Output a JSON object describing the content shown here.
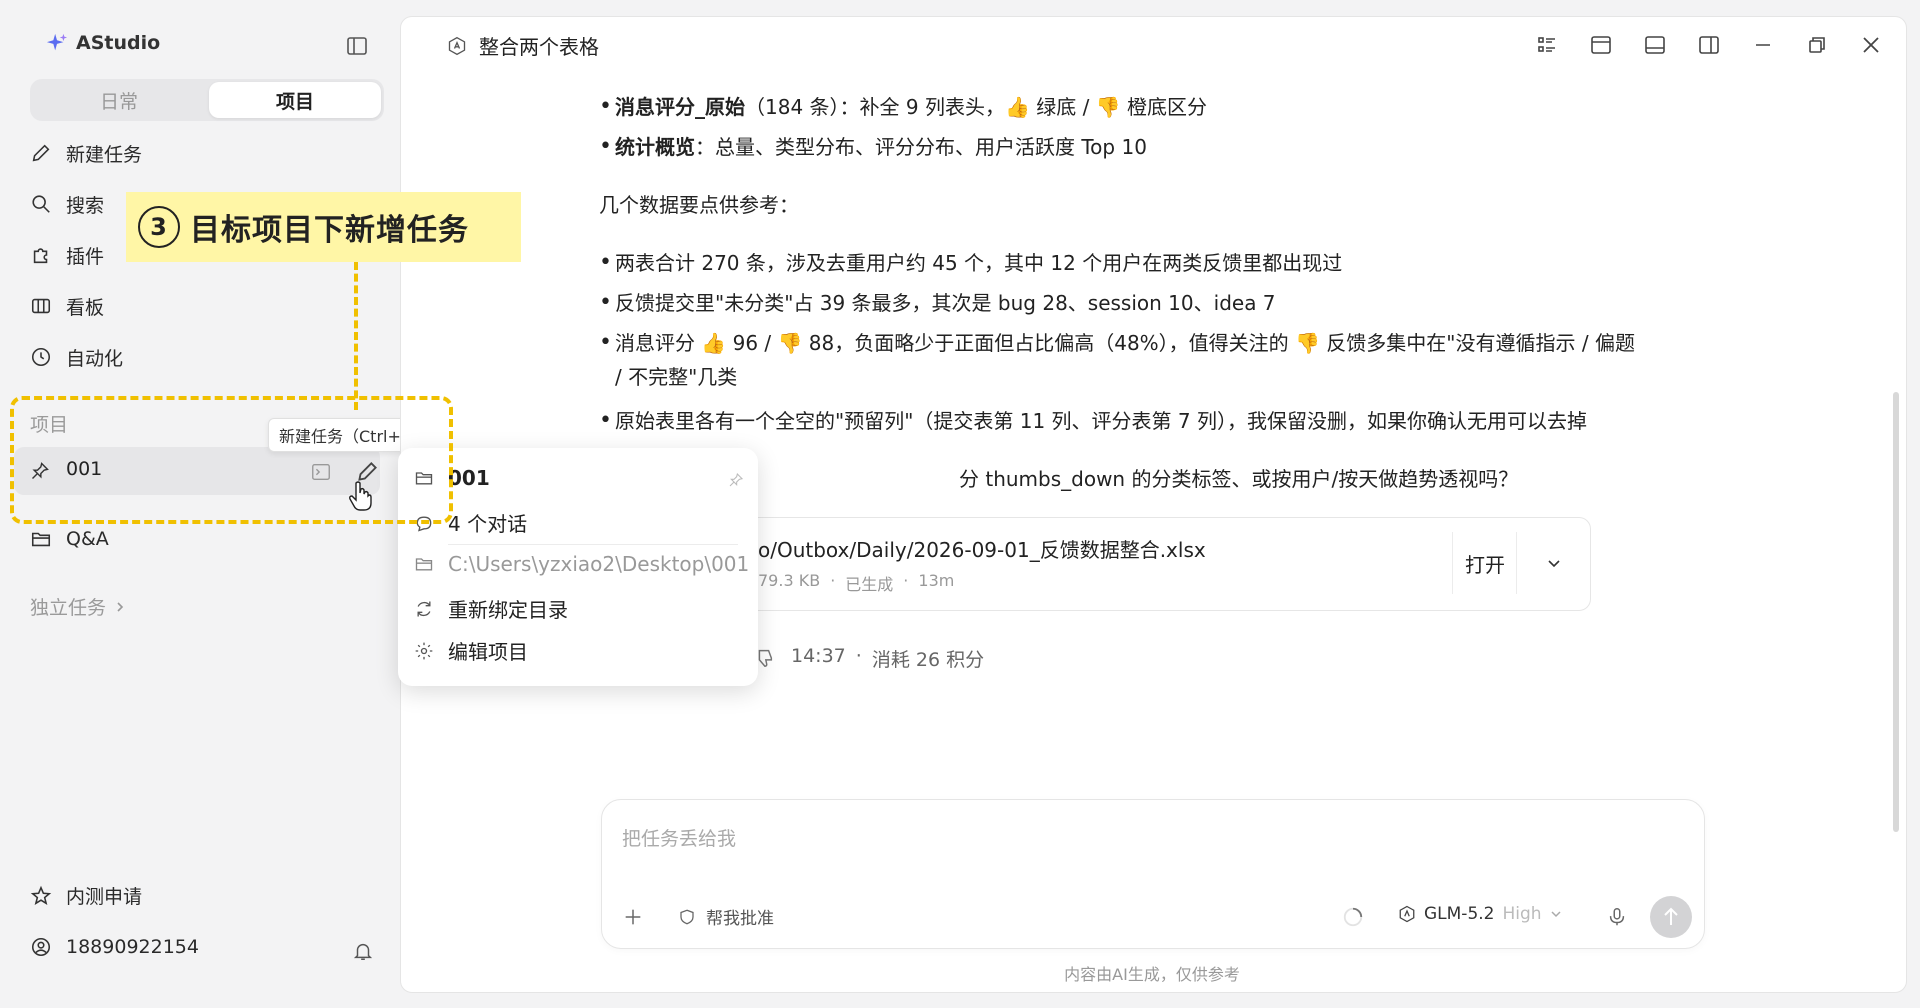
{
  "app": {
    "name": "AStudio"
  },
  "sidebar": {
    "segments": [
      "日常",
      "项目"
    ],
    "active_segment": "项目",
    "nav": [
      {
        "label": "新建任务",
        "icon": "pencil-icon"
      },
      {
        "label": "搜索",
        "icon": "search-icon"
      },
      {
        "label": "插件",
        "icon": "plugin-icon"
      },
      {
        "label": "看板",
        "icon": "kanban-icon"
      },
      {
        "label": "自动化",
        "icon": "clock-icon"
      }
    ],
    "projects_label": "项目",
    "project": {
      "name": "001"
    },
    "tooltip": "新建任务（Ctrl+N）",
    "qa": "Q&A",
    "independent": "独立任务",
    "beta": "内测申请",
    "user": "18890922154"
  },
  "annotation": {
    "number": "3",
    "text": "目标项目下新增任务",
    "color": "#f0c000"
  },
  "main": {
    "title": "整合两个表格",
    "bullets1": [
      {
        "bold": "消息评分_原始",
        "text": "（184 条）：补全 9 列表头，👍 绿底 / 👎 橙底区分"
      },
      {
        "bold": "统计概览",
        "text": "：总量、类型分布、评分分布、用户活跃度 Top 10"
      }
    ],
    "intro": "几个数据要点供参考：",
    "bullets2": [
      "两表合计 270 条，涉及去重用户约 45 个，其中 12 个用户在两类反馈里都出现过",
      "反馈提交里\"未分类\"占 39 条最多，其次是 bug 28、session 10、idea 7",
      "消息评分 👍 96 / 👎 88，负面略少于正面但占比偏高（48%），值得关注的 👎 反馈多集中在\"没有遵循指示 / 偏题",
      "/ 不完整\"几类",
      "原始表里各有一个全空的\"预留列\"（提交表第 11 列、评分表第 7 列），我保留没删，如果你确认无用可以去掉"
    ],
    "question": "分 thumbs_down 的分类标签、或按用户/按天做趋势透视吗？",
    "file": {
      "name": "o/Outbox/Daily/2026-09-01_反馈数据整合.xlsx",
      "size": "79.3 KB",
      "status": "已生成",
      "age": "13m",
      "open_label": "打开"
    },
    "msg_time": "14:37",
    "msg_cost": "消耗 26 积分"
  },
  "popup": {
    "name": "001",
    "conversations": "4 个对话",
    "path": "C:\\Users\\yzxiao2\\Desktop\\001",
    "rebind": "重新绑定目录",
    "edit": "编辑项目"
  },
  "composer": {
    "placeholder": "把任务丢给我",
    "approve": "帮我批准",
    "model": "GLM-5.2",
    "level": "High",
    "disclaimer": "内容由AI生成，仅供参考"
  }
}
